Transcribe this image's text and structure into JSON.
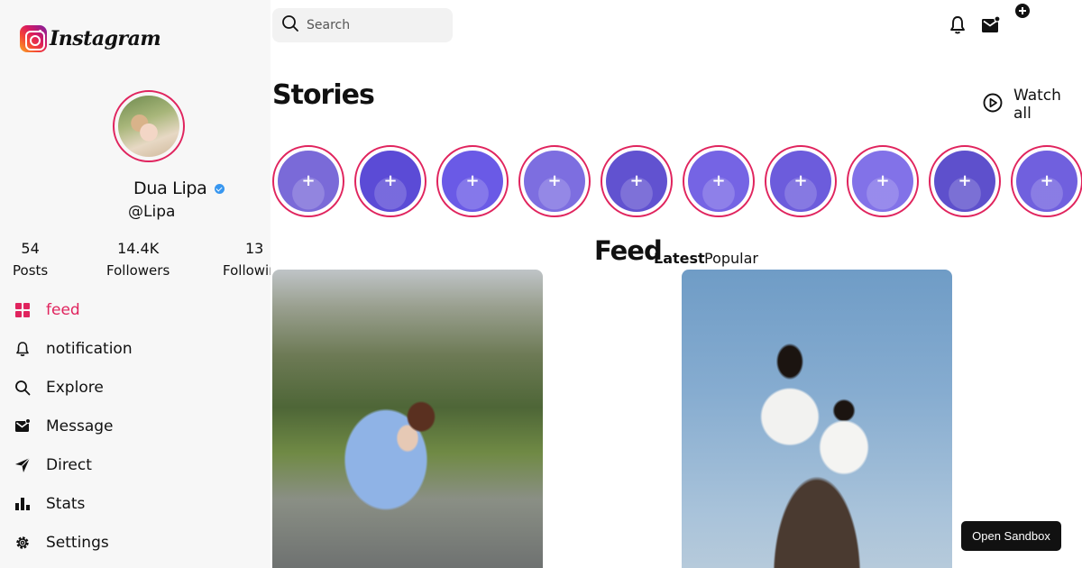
{
  "app": {
    "logo_text": "Instagram"
  },
  "profile": {
    "name": "Dua Lipa",
    "handle": "@Lipa",
    "stats": [
      {
        "value": "54",
        "label": "Posts"
      },
      {
        "value": "14.4K",
        "label": "Followers"
      },
      {
        "value": "13",
        "label": "Following"
      }
    ]
  },
  "nav": [
    {
      "label": "feed",
      "icon": "grid-icon",
      "active": true
    },
    {
      "label": "notification",
      "icon": "bell-icon"
    },
    {
      "label": "Explore",
      "icon": "search-icon"
    },
    {
      "label": "Message",
      "icon": "mail-icon"
    },
    {
      "label": "Direct",
      "icon": "send-icon"
    },
    {
      "label": "Stats",
      "icon": "bar-chart-icon"
    },
    {
      "label": "Settings",
      "icon": "gear-icon"
    }
  ],
  "search": {
    "placeholder": "Search"
  },
  "stories": {
    "title": "Stories",
    "watch_all": "Watch all",
    "count": 10,
    "add_symbol": "+"
  },
  "feed": {
    "title": "Feed",
    "tabs": [
      "Latest",
      "Popular"
    ]
  },
  "sandbox_label": "Open Sandbox",
  "colors": {
    "accent": "#e0245e",
    "story_overlay": "#6e5cf0",
    "verified": "#3897f0"
  }
}
